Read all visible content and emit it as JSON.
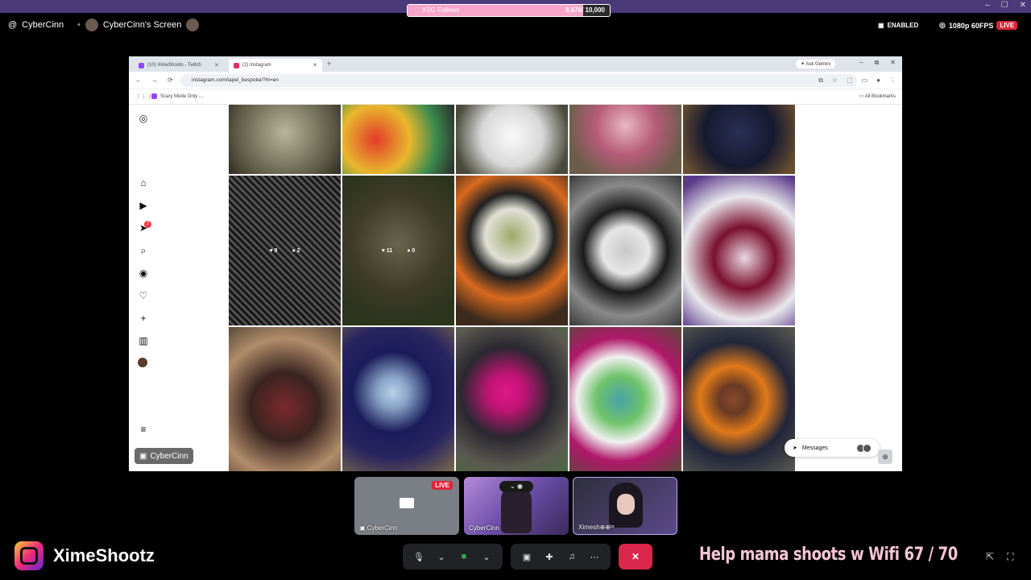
{
  "overlay": {
    "follow_goal": {
      "label": "XSG Follows",
      "current": "8,670",
      "total": "/ 10,000",
      "progress": 0.867
    },
    "window_controls": [
      "–",
      "☐",
      "✕"
    ]
  },
  "call": {
    "user": "CyberCinn",
    "screen_title": "CyberCinn's Screen",
    "enabled_label": "ENABLED",
    "quality": "1080p 60FPS",
    "live": "LIVE"
  },
  "browser": {
    "tabs": [
      {
        "label": "(10) XimeShoots - Twitch",
        "color": "#9146ff"
      },
      {
        "label": "(2) Instagram",
        "color": "#e1306c"
      }
    ],
    "new_tab": "+",
    "ask_gemini": "Ask Gemini",
    "window_controls": [
      "–",
      "⧉",
      "✕"
    ],
    "nav": [
      "←",
      "→",
      "⟳"
    ],
    "url": "instagram.com/lapel_bespoke/?hl=en",
    "bookmark": "Scary Mode Only -...",
    "all_bookmarks": "All Bookmarks"
  },
  "instagram": {
    "sidebar_icons": [
      "instagram-icon",
      "home-icon",
      "reels-icon",
      "messenger-icon",
      "search-icon",
      "explore-icon",
      "notifications-icon",
      "create-icon",
      "dashboard-icon",
      "profile-icon",
      "menu-icon"
    ],
    "notification_badge": "2",
    "hovered_posts": [
      {
        "likes": "9",
        "comments": "2"
      },
      {
        "likes": "11",
        "comments": "0"
      }
    ],
    "messages_label": "Messages",
    "messages_badge": "2"
  },
  "screen_owner_tag": "CyberCinn",
  "participants": [
    {
      "name": "CyberCinn",
      "live": "LIVE"
    },
    {
      "name": "CyberCinn"
    },
    {
      "name": "Ximesh⊕⊕ᵗˢ"
    }
  ],
  "brand": {
    "name": "XimeShootz"
  },
  "ticker": {
    "text": "Help mama shoots w Wifi  67 / 70"
  },
  "colors": {
    "end_call": "#d9264a",
    "live": "#e0243a",
    "accent_purple": "#4a3a7a"
  }
}
